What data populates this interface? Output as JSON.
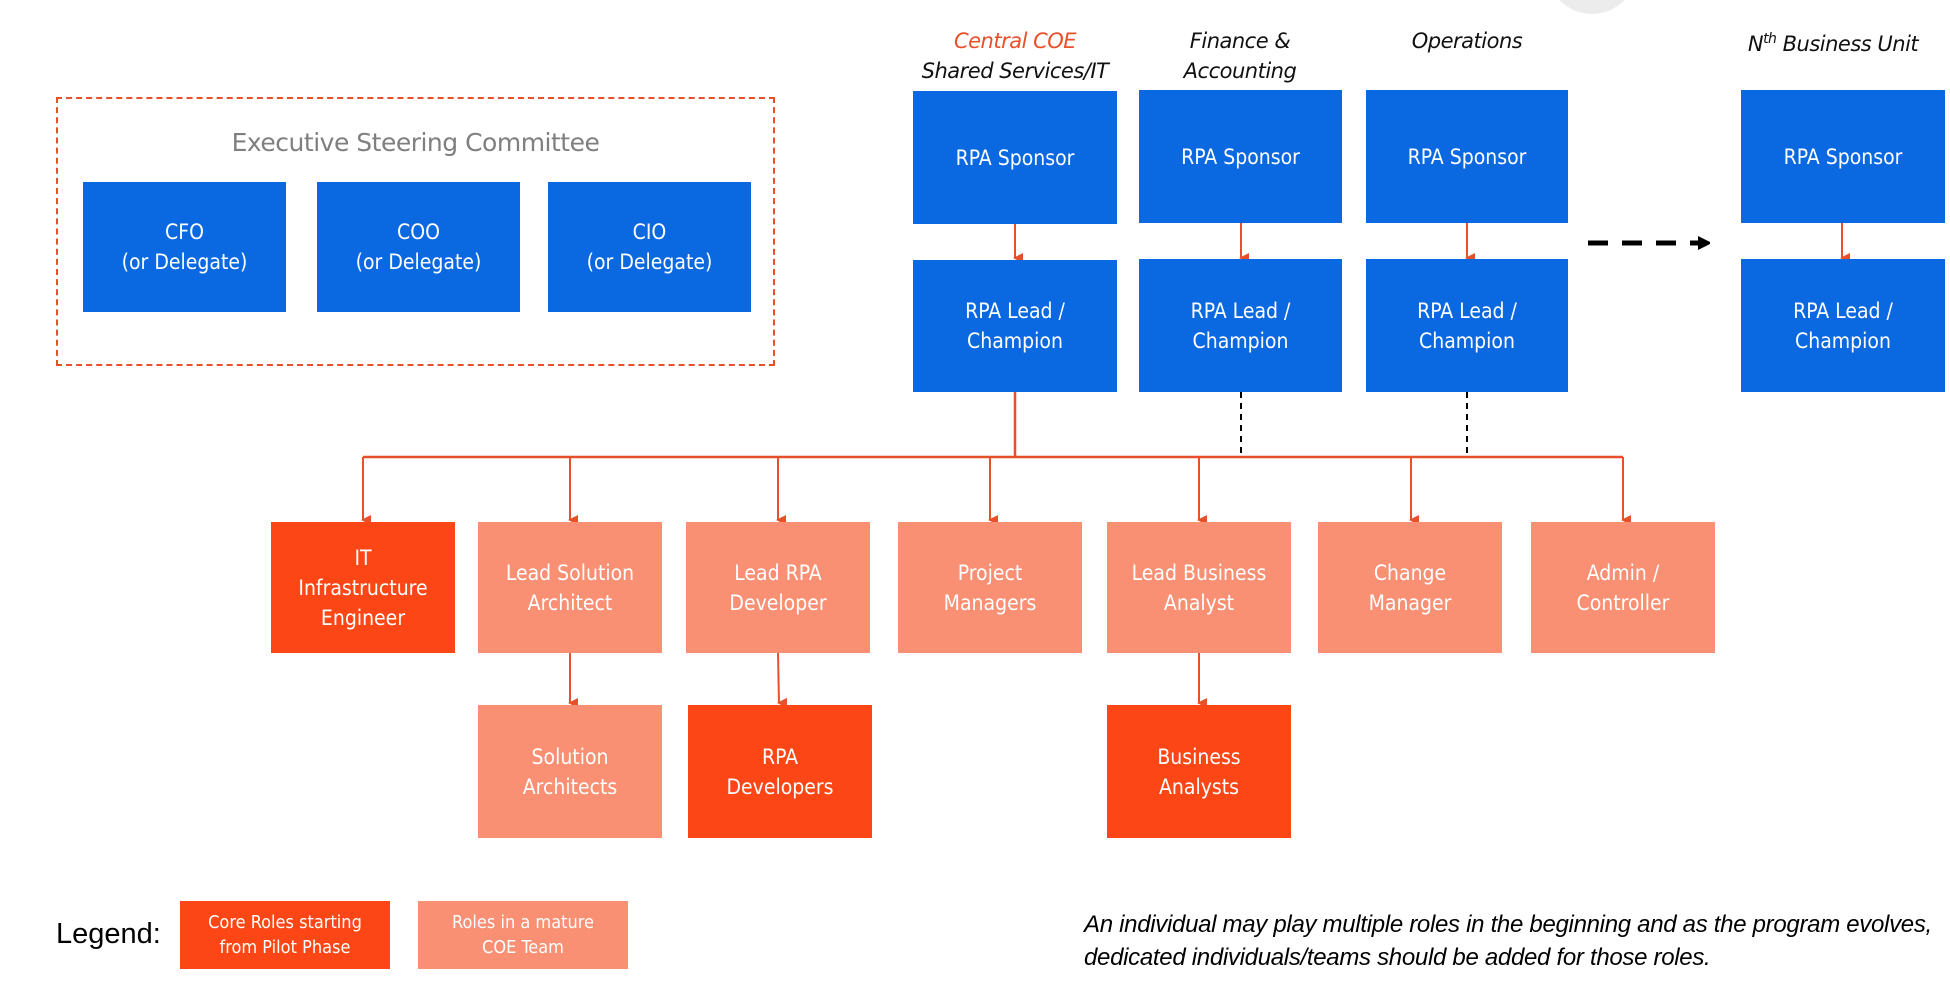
{
  "executive_committee": {
    "title": "Executive Steering Committee",
    "members": [
      {
        "label": "CFO\n(or Delegate)"
      },
      {
        "label": "COO\n(or Delegate)"
      },
      {
        "label": "CIO\n(or Delegate)"
      }
    ]
  },
  "business_units": [
    {
      "header_accent": "Central COE",
      "header": "Shared Services/IT",
      "sponsor": "RPA Sponsor",
      "lead": "RPA Lead /\nChampion"
    },
    {
      "header_accent": "",
      "header": "Finance &\nAccounting",
      "sponsor": "RPA Sponsor",
      "lead": "RPA Lead /\nChampion"
    },
    {
      "header_accent": "",
      "header": "Operations",
      "sponsor": "RPA Sponsor",
      "lead": "RPA Lead /\nChampion"
    },
    {
      "header_accent": "",
      "header_prefix": "N",
      "header_sup": "th",
      "header": " Business Unit",
      "sponsor": "RPA Sponsor",
      "lead": "RPA Lead /\nChampion"
    }
  ],
  "coe_roles": [
    {
      "label": "IT\nInfrastructure\nEngineer",
      "type": "core"
    },
    {
      "label": "Lead Solution\nArchitect",
      "type": "mature"
    },
    {
      "label": "Lead RPA\nDeveloper",
      "type": "mature"
    },
    {
      "label": "Project\nManagers",
      "type": "mature"
    },
    {
      "label": "Lead Business\nAnalyst",
      "type": "mature"
    },
    {
      "label": "Change\nManager",
      "type": "mature"
    },
    {
      "label": "Admin /\nController",
      "type": "mature"
    }
  ],
  "sub_roles": [
    {
      "label": "Solution\nArchitects",
      "type": "mature",
      "parent": "Lead Solution Architect"
    },
    {
      "label": "RPA\nDevelopers",
      "type": "core",
      "parent": "Lead RPA Developer"
    },
    {
      "label": "Business\nAnalysts",
      "type": "core",
      "parent": "Lead Business Analyst"
    }
  ],
  "legend": {
    "label": "Legend:",
    "items": [
      {
        "label": "Core Roles starting\nfrom Pilot Phase",
        "type": "core"
      },
      {
        "label": "Roles in a mature\nCOE Team",
        "type": "mature"
      }
    ]
  },
  "note": "An individual may play multiple roles in the beginning and as the program evolves, dedicated individuals/teams should be added for those roles.",
  "colors": {
    "blue": "#0A68E0",
    "core": "#FC4616",
    "mature": "#F98F73",
    "connector": "#E8502A",
    "accent_text": "#E8502A"
  }
}
